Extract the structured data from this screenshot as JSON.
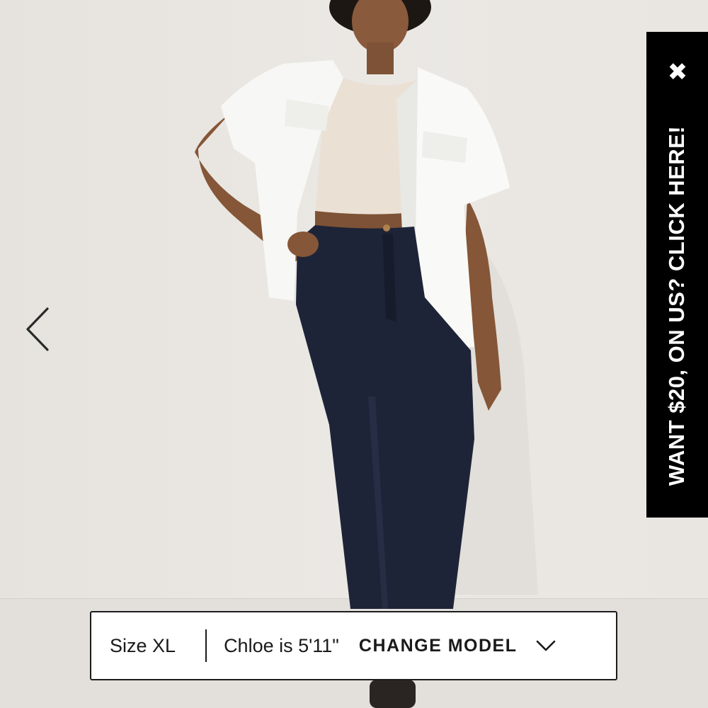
{
  "gallery": {
    "prev_icon": "chevron-left-icon",
    "photo_alt": "model-photo"
  },
  "promo": {
    "text": "WANT $20, ON US? CLICK HERE!",
    "close_icon": "close-icon",
    "background": "#000000",
    "text_color": "#ffffff"
  },
  "model_bar": {
    "size_label": "Size XL",
    "model_info": "Chloe is 5'11\"",
    "change_label": "CHANGE MODEL",
    "dropdown_icon": "chevron-down-icon"
  }
}
